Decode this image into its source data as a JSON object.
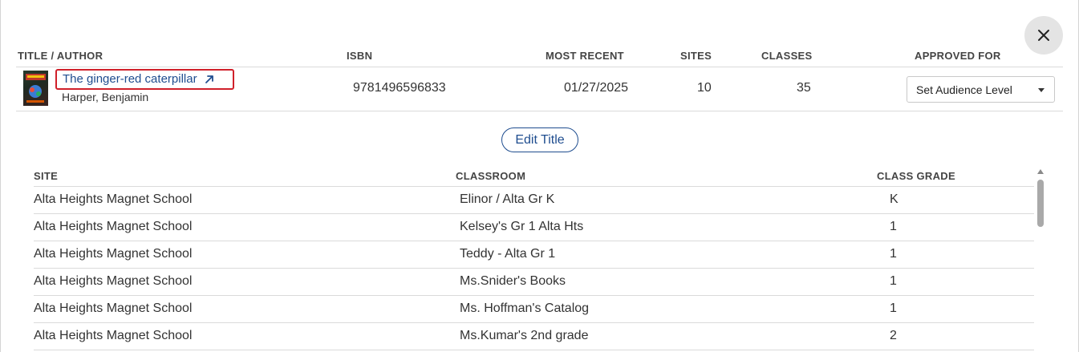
{
  "book_table": {
    "headers": {
      "title_author": "TITLE / AUTHOR",
      "isbn": "ISBN",
      "most_recent": "MOST RECENT",
      "sites": "SITES",
      "classes": "CLASSES",
      "approved_for": "APPROVED FOR"
    },
    "book": {
      "title": "The ginger-red caterpillar",
      "author": "Harper, Benjamin",
      "isbn": "9781496596833",
      "most_recent": "01/27/2025",
      "sites": "10",
      "classes": "35",
      "audience_select": "Set Audience Level"
    }
  },
  "actions": {
    "edit_title_label": "Edit Title"
  },
  "class_table": {
    "headers": {
      "site": "SITE",
      "classroom": "CLASSROOM",
      "class_grade": "CLASS GRADE"
    },
    "rows": [
      {
        "site": "Alta Heights Magnet School",
        "classroom": "Elinor / Alta Gr K",
        "grade": "K"
      },
      {
        "site": "Alta Heights Magnet School",
        "classroom": "Kelsey's Gr 1 Alta Hts",
        "grade": "1"
      },
      {
        "site": "Alta Heights Magnet School",
        "classroom": "Teddy - Alta Gr 1",
        "grade": "1"
      },
      {
        "site": "Alta Heights Magnet School",
        "classroom": "Ms.Snider's Books",
        "grade": "1"
      },
      {
        "site": "Alta Heights Magnet School",
        "classroom": "Ms. Hoffman's Catalog",
        "grade": "1"
      },
      {
        "site": "Alta Heights Magnet School",
        "classroom": "Ms.Kumar's 2nd grade",
        "grade": "2"
      }
    ]
  },
  "icons": {
    "close": "close-icon",
    "external_link": "external-link-icon",
    "dropdown": "chevron-down-icon"
  }
}
